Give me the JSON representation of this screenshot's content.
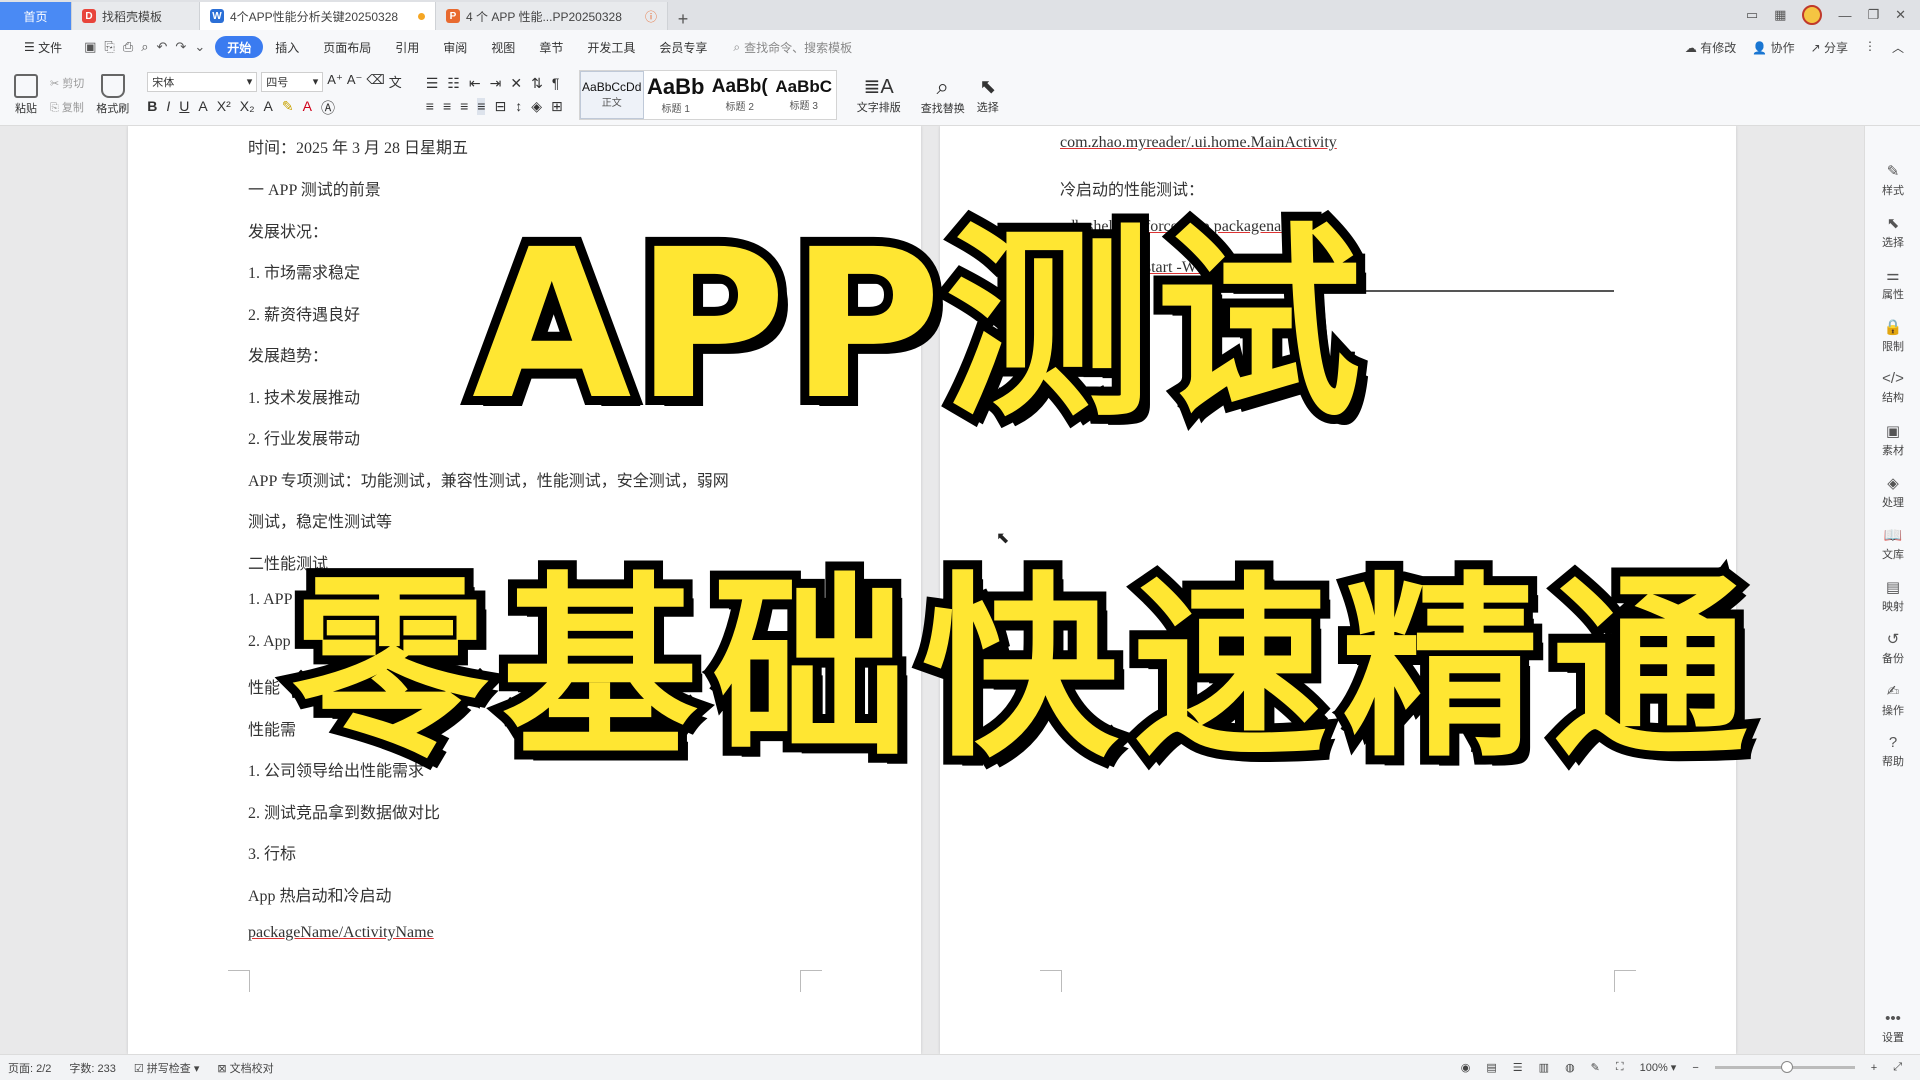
{
  "tabs": {
    "home": "首页",
    "template": "找稻壳模板",
    "doc_active": "4个APP性能分析关键20250328",
    "doc_other": "4 个 APP 性能...PP20250328"
  },
  "menu": {
    "file": "文件",
    "items": [
      "开始",
      "插入",
      "页面布局",
      "引用",
      "审阅",
      "视图",
      "章节",
      "开发工具",
      "会员专享"
    ],
    "search_placeholder": "查找命令、搜索模板",
    "right": [
      "有修改",
      "协作",
      "分享"
    ]
  },
  "ribbon": {
    "paste": "粘贴",
    "cut": "剪切",
    "copy": "复制",
    "format_painter": "格式刷",
    "font_name": "宋体",
    "font_size": "四号",
    "styles": [
      {
        "sample": "AaBbCcDd",
        "label": "正文"
      },
      {
        "sample": "AaBb",
        "label": "标题 1"
      },
      {
        "sample": "AaBb(",
        "label": "标题 2"
      },
      {
        "sample": "AaBbC",
        "label": "标题 3"
      }
    ],
    "text_layout": "文字排版",
    "find_replace": "查找替换",
    "select": "选择"
  },
  "left_page": {
    "lines": [
      "时间：2025 年 3 月 28 日星期五",
      "一 APP 测试的前景",
      "发展状况：",
      "1. 市场需求稳定",
      "2. 薪资待遇良好",
      "发展趋势：",
      "1. 技术发展推动",
      "2. 行业发展带动",
      "APP 专项测试：功能测试，兼容性测试，性能测试，安全测试，弱网",
      "测试，稳定性测试等",
      "二性能测试",
      "1. APP",
      "2. App",
      "性能",
      "性能需",
      "1. 公司领导给出性能需求",
      "2. 测试竞品拿到数据做对比",
      "3. 行标",
      "App 热启动和冷启动",
      "packageName/ActivityName"
    ]
  },
  "right_page": {
    "lines": [
      "com.zhao.myreader/.ui.home.MainActivity",
      "冷启动的性能测试：",
      "adb shell am force-stop packagename",
      "adb shell am start -W -n com.zhao.myreader"
    ]
  },
  "overlay": {
    "title": "APP测试",
    "subtitle": "零基础快速精通"
  },
  "sidebar": [
    "样式",
    "选择",
    "属性",
    "限制",
    "结构",
    "素材",
    "处理",
    "文库",
    "映射",
    "备份",
    "操作",
    "帮助",
    "设置"
  ],
  "status": {
    "page": "页面: 2/2",
    "words": "字数: 233",
    "spell": "拼写检查",
    "proof": "文档校对",
    "zoom": "100%"
  }
}
